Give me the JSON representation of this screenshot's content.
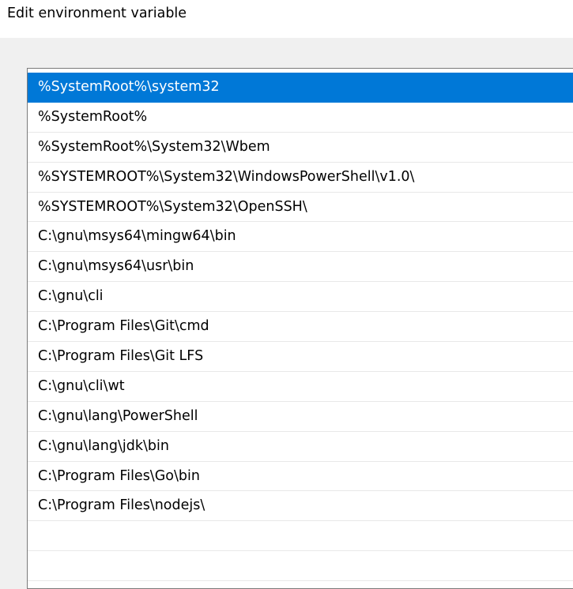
{
  "dialog": {
    "title": "Edit environment variable"
  },
  "list": {
    "selected_index": 0,
    "items": [
      "%SystemRoot%\\system32",
      "%SystemRoot%",
      "%SystemRoot%\\System32\\Wbem",
      "%SYSTEMROOT%\\System32\\WindowsPowerShell\\v1.0\\",
      "%SYSTEMROOT%\\System32\\OpenSSH\\",
      "C:\\gnu\\msys64\\mingw64\\bin",
      "C:\\gnu\\msys64\\usr\\bin",
      "C:\\gnu\\cli",
      "C:\\Program Files\\Git\\cmd",
      "C:\\Program Files\\Git LFS",
      "C:\\gnu\\cli\\wt",
      "C:\\gnu\\lang\\PowerShell",
      "C:\\gnu\\lang\\jdk\\bin",
      "C:\\Program Files\\Go\\bin",
      "C:\\Program Files\\nodejs\\",
      "",
      ""
    ]
  },
  "colors": {
    "selection": "#0078d7",
    "dialog_background": "#f0f0f0",
    "titlebar_background": "#ffffff"
  }
}
